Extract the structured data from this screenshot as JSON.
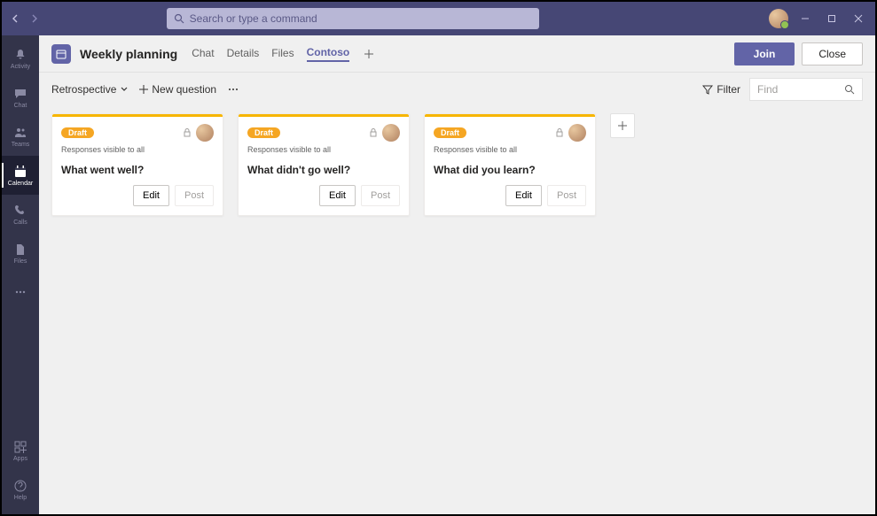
{
  "titlebar": {
    "search_placeholder": "Search or type a command"
  },
  "rail": {
    "items": [
      {
        "id": "activity",
        "label": "Activity"
      },
      {
        "id": "chat",
        "label": "Chat"
      },
      {
        "id": "teams",
        "label": "Teams"
      },
      {
        "id": "calendar",
        "label": "Calendar"
      },
      {
        "id": "calls",
        "label": "Calls"
      },
      {
        "id": "files",
        "label": "Files"
      }
    ],
    "bottom": [
      {
        "id": "apps",
        "label": "Apps"
      },
      {
        "id": "help",
        "label": "Help"
      }
    ],
    "active": "calendar"
  },
  "header": {
    "title": "Weekly planning",
    "tabs": [
      {
        "label": "Chat",
        "active": false
      },
      {
        "label": "Details",
        "active": false
      },
      {
        "label": "Files",
        "active": false
      },
      {
        "label": "Contoso",
        "active": true
      }
    ],
    "join_label": "Join",
    "close_label": "Close"
  },
  "toolbar": {
    "view_label": "Retrospective",
    "new_question_label": "New question",
    "filter_label": "Filter",
    "find_placeholder": "Find"
  },
  "board": {
    "cards": [
      {
        "badge": "Draft",
        "visibility": "Responses visible to all",
        "question": "What went well?",
        "edit": "Edit",
        "post": "Post"
      },
      {
        "badge": "Draft",
        "visibility": "Responses visible to all",
        "question": "What didn't go well?",
        "edit": "Edit",
        "post": "Post"
      },
      {
        "badge": "Draft",
        "visibility": "Responses visible to all",
        "question": "What did you learn?",
        "edit": "Edit",
        "post": "Post"
      }
    ]
  },
  "colors": {
    "brand": "#6264a7",
    "accent": "#f7b500"
  }
}
